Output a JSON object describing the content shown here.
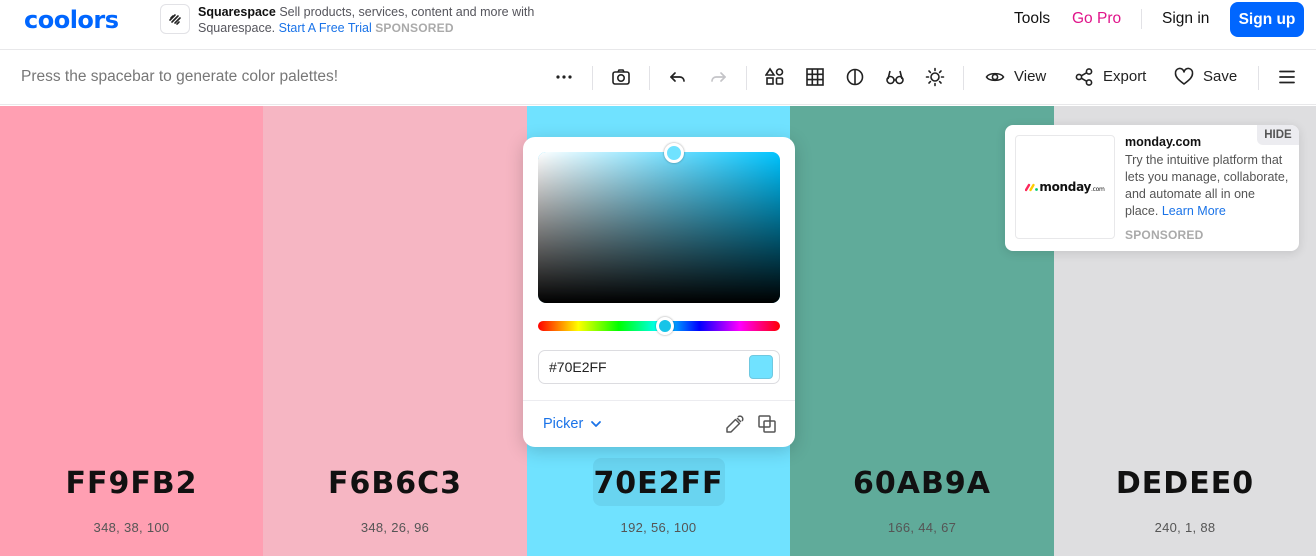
{
  "header": {
    "logo": "coolors",
    "sponsor": {
      "name": "Squarespace",
      "text": "Sell products, services, content and more with Squarespace.",
      "link": "Start A Free Trial",
      "tag": "SPONSORED"
    },
    "nav": {
      "tools": "Tools",
      "gopro": "Go Pro",
      "signin": "Sign in",
      "signup": "Sign up"
    }
  },
  "toolbar": {
    "hint": "Press the spacebar to generate color palettes!",
    "view": "View",
    "export": "Export",
    "save": "Save"
  },
  "palette": {
    "colors": [
      {
        "hex": "FF9FB2",
        "color": "#FF9FB2",
        "hsb": "348, 38, 100"
      },
      {
        "hex": "F6B6C3",
        "color": "#F6B6C3",
        "hsb": "348, 26, 96"
      },
      {
        "hex": "70E2FF",
        "color": "#70E2FF",
        "hsb": "192, 56, 100"
      },
      {
        "hex": "60AB9A",
        "color": "#60AB9A",
        "hsb": "166, 44, 67"
      },
      {
        "hex": "DEDEE0",
        "color": "#DEDEE0",
        "hsb": "240, 1, 88"
      }
    ]
  },
  "picker": {
    "value": "#70E2FF",
    "mode": "Picker"
  },
  "ad": {
    "brand": "monday",
    "brand_suffix": ".com",
    "title": "monday.com",
    "desc": "Try the intuitive platform that lets you manage, collaborate, and automate all in one place.",
    "link": "Learn More",
    "tag": "SPONSORED",
    "hide": "HIDE"
  },
  "colors": {
    "accent": "#0066ff",
    "gopro": "#e0148a"
  }
}
